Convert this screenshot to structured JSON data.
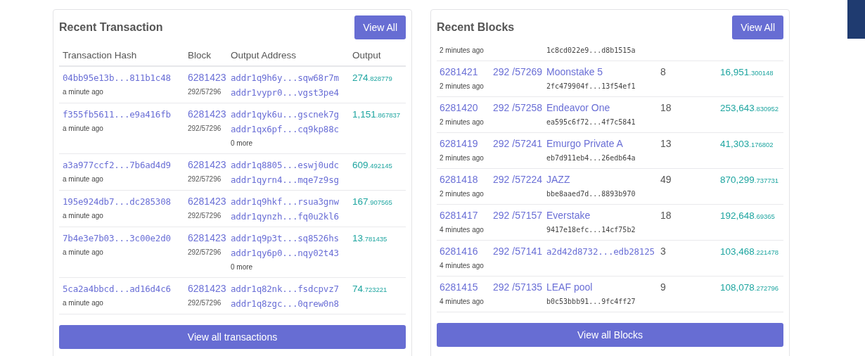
{
  "transactions": {
    "title": "Recent Transaction",
    "view_all": "View All",
    "columns": [
      "Transaction Hash",
      "Block",
      "Output Address",
      "Output"
    ],
    "rows": [
      {
        "hash": "04bb95e13b...811b1c48",
        "age": "a minute ago",
        "block": "6281423",
        "slot": "292/57296",
        "addresses": [
          "addr1q9h6y...sqw68r7m",
          "addr1vypr0...vgst3pe4"
        ],
        "output": {
          "whole": "274",
          "fraction": ".828779"
        }
      },
      {
        "hash": "f355fb5611...e9a416fb",
        "age": "a minute ago",
        "block": "6281423",
        "slot": "292/57296",
        "addresses": [
          "addr1qyk6u...gscnek7g",
          "addr1qx6pf...cq9kp88c"
        ],
        "more": "0 more",
        "output": {
          "whole": "1,151",
          "fraction": ".867837"
        }
      },
      {
        "hash": "a3a977ccf2...7b6ad4d9",
        "age": "a minute ago",
        "block": "6281423",
        "slot": "292/57296",
        "addresses": [
          "addr1q8805...eswj0udc",
          "addr1qyrn4...mqe7z9sg"
        ],
        "output": {
          "whole": "609",
          "fraction": ".492145"
        }
      },
      {
        "hash": "195e924db7...dc285308",
        "age": "a minute ago",
        "block": "6281423",
        "slot": "292/57296",
        "addresses": [
          "addr1q9hkf...rsua3gnw",
          "addr1qynzh...fq0u2kl6"
        ],
        "output": {
          "whole": "167",
          "fraction": ".907565"
        }
      },
      {
        "hash": "7b4e3e7b03...3c00e2d0",
        "age": "a minute ago",
        "block": "6281423",
        "slot": "292/57296",
        "addresses": [
          "addr1q9p3t...sq8526hs",
          "addr1qy6p0...nqy02t43"
        ],
        "more": "0 more",
        "output": {
          "whole": "13",
          "fraction": ".781435"
        }
      },
      {
        "hash": "5ca2a4bbcd...ad16d4c6",
        "age": "a minute ago",
        "block": "6281423",
        "slot": "292/57296",
        "addresses": [
          "addr1q82nk...fsdcpvz7",
          "addr1q8zgc...0qrew0n8"
        ],
        "output": {
          "whole": "74",
          "fraction": ".723221"
        }
      }
    ],
    "footer_button": "View all transactions"
  },
  "blocks": {
    "title": "Recent Blocks",
    "view_all": "View All",
    "rows": [
      {
        "age": "2 minutes ago",
        "pool_hash": "1c8cd022e9...d8b1515a"
      },
      {
        "block": "6281421",
        "age": "2 minutes ago",
        "slot": "292 /57269",
        "pool": "Moonstake 5",
        "pool_hash": "2fc479904f...13f54ef1",
        "txs": "8",
        "output": {
          "whole": "16,951",
          "fraction": ".300148"
        }
      },
      {
        "block": "6281420",
        "age": "2 minutes ago",
        "slot": "292 /57258",
        "pool": "Endeavor One",
        "pool_hash": "ea595c6f72...4f7c5841",
        "txs": "18",
        "output": {
          "whole": "253,643",
          "fraction": ".830952"
        }
      },
      {
        "block": "6281419",
        "age": "2 minutes ago",
        "slot": "292 /57241",
        "pool": "Emurgo Private A",
        "pool_hash": "eb7d911eb4...26edb64a",
        "txs": "13",
        "output": {
          "whole": "41,303",
          "fraction": ".176802"
        }
      },
      {
        "block": "6281418",
        "age": "2 minutes ago",
        "slot": "292 /57224",
        "pool": "JAZZ",
        "pool_hash": "bbe8aaed7d...8893b970",
        "txs": "49",
        "output": {
          "whole": "870,299",
          "fraction": ".737731"
        }
      },
      {
        "block": "6281417",
        "age": "4 minutes ago",
        "slot": "292 /57157",
        "pool": "Everstake",
        "pool_hash": "9417e18efc...14cf75b2",
        "txs": "18",
        "output": {
          "whole": "192,648",
          "fraction": ".69365"
        }
      },
      {
        "block": "6281416",
        "age": "4 minutes ago",
        "slot": "292 /57141",
        "pool_id": "a2d42d8732...edb28125",
        "txs": "3",
        "output": {
          "whole": "103,468",
          "fraction": ".221478"
        }
      },
      {
        "block": "6281415",
        "age": "4 minutes ago",
        "slot": "292 /57135",
        "pool": "LEAF pool",
        "pool_hash": "b0c53bbb91...9fc4ff27",
        "txs": "9",
        "output": {
          "whole": "108,078",
          "fraction": ".272796"
        }
      }
    ],
    "footer_button": "View all Blocks"
  }
}
